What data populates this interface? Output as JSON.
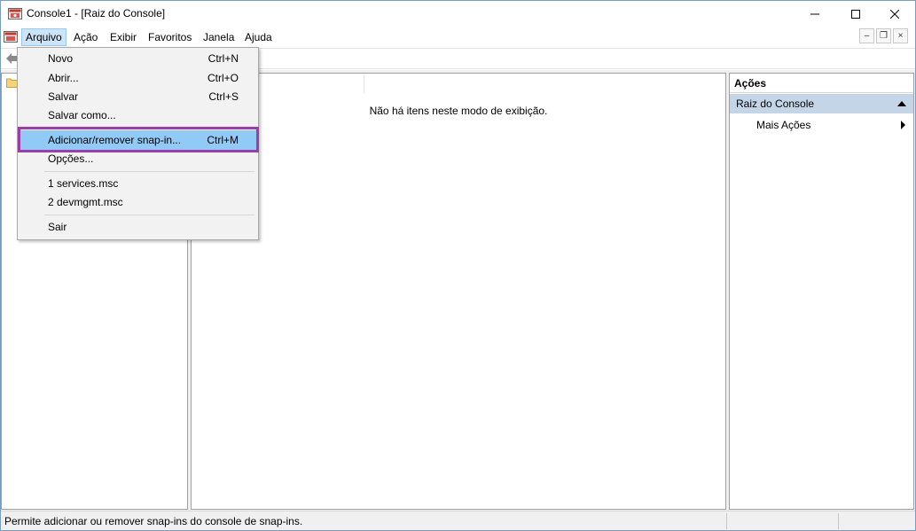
{
  "window": {
    "title": "Console1 - [Raiz do Console]",
    "controls": {
      "minimize": "minimize-icon",
      "maximize": "maximize-icon",
      "close": "close-icon"
    }
  },
  "menubar": {
    "items": [
      "Arquivo",
      "Ação",
      "Exibir",
      "Favoritos",
      "Janela",
      "Ajuda"
    ],
    "active": "Arquivo"
  },
  "file_menu": {
    "items": [
      {
        "label": "Novo",
        "shortcut": "Ctrl+N"
      },
      {
        "label": "Abrir...",
        "shortcut": "Ctrl+O"
      },
      {
        "label": "Salvar",
        "shortcut": "Ctrl+S"
      },
      {
        "label": "Salvar como...",
        "shortcut": ""
      },
      {
        "label": "Adicionar/remover snap-in...",
        "shortcut": "Ctrl+M"
      },
      {
        "label": "Opções...",
        "shortcut": ""
      },
      {
        "label": "1 services.msc",
        "shortcut": ""
      },
      {
        "label": "2 devmgmt.msc",
        "shortcut": ""
      },
      {
        "label": "Sair",
        "shortcut": ""
      }
    ],
    "highlighted": "Adicionar/remover snap-in..."
  },
  "center": {
    "empty_message": "Não há itens neste modo de exibição."
  },
  "actions": {
    "title": "Ações",
    "section": "Raiz do Console",
    "more": "Mais Ações"
  },
  "status": {
    "text": "Permite adicionar ou remover snap-ins do console de snap-ins."
  },
  "colors": {
    "highlight_border": "#9b3fa7",
    "menu_hover": "#91c9f7",
    "actions_section": "#c5d5e8"
  }
}
